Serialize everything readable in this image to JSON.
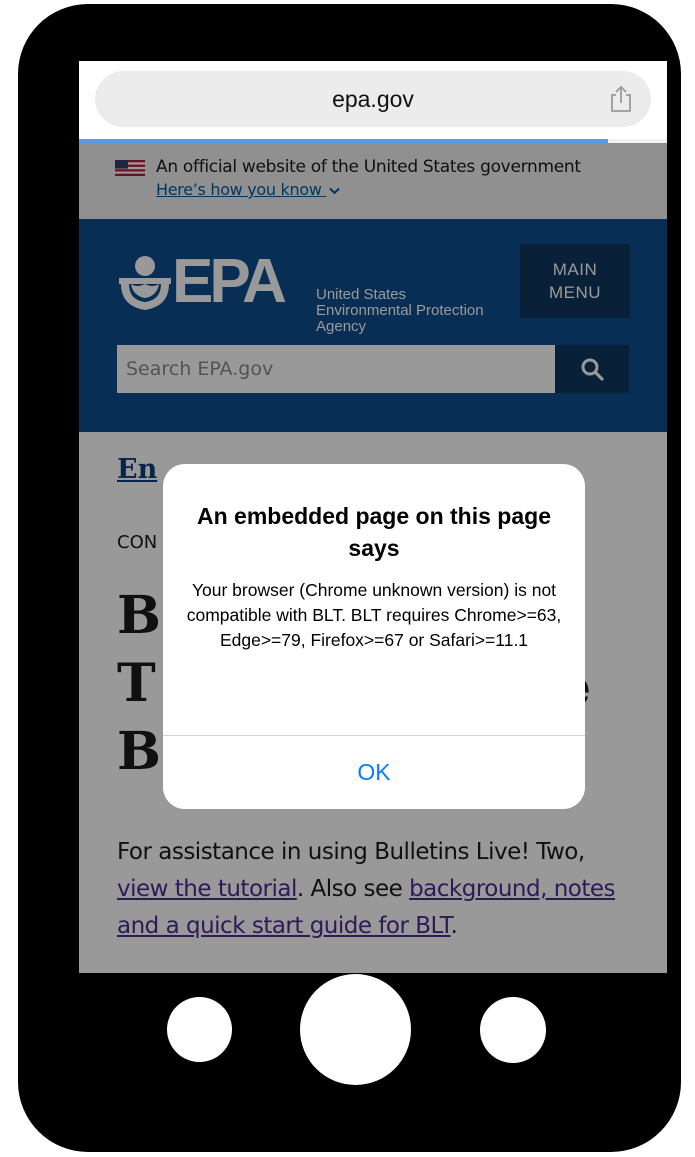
{
  "browser": {
    "url": "epa.gov",
    "load_progress": 0.9
  },
  "banner": {
    "official_text": "An official website of the United States government",
    "how_you_know": "Here’s how you know"
  },
  "header": {
    "logo_text": "EPA",
    "agency_line1": "United States",
    "agency_line2": "Environmental Protection",
    "agency_line3": "Agency",
    "menu_line1": "MAIN",
    "menu_line2": "MENU",
    "search_placeholder": "Search EPA.gov"
  },
  "content": {
    "breadcrumb": "En",
    "category": "CON",
    "title_line1": "B",
    "title_line2": "T",
    "title_line3": "B",
    "title_line2_end": "e",
    "para_intro": "For assistance in using Bulletins Live! Two, ",
    "link_tutorial": "view the tutorial",
    "para_mid": ". Also see ",
    "link_background": "background, notes and a quick start guide for BLT",
    "para_end": "."
  },
  "dialog": {
    "title": "An embedded page on this page says",
    "message": "Your browser (Chrome unknown version) is not compatible with BLT. BLT requires Chrome>=63, Edge>=79, Firefox>=67 or Safari>=11.1",
    "ok_label": "OK"
  },
  "colors": {
    "epa_blue": "#0e4d8f",
    "menu_navy": "#10365f",
    "ios_blue": "#0a7aff",
    "link_blue": "#005ea2",
    "link_purple": "#4c2c92"
  },
  "icons": [
    "share-icon",
    "us-flag-icon",
    "chevron-down-icon",
    "epa-flower-icon",
    "search-icon"
  ]
}
